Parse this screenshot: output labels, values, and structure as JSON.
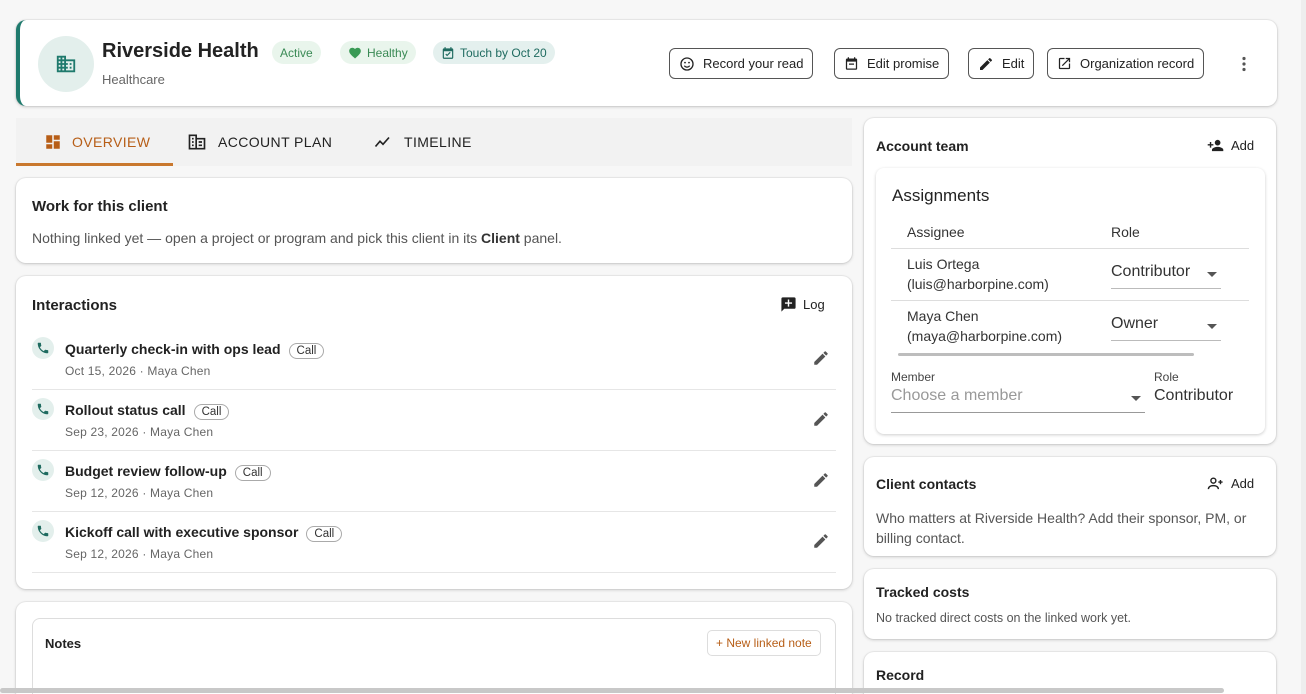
{
  "header": {
    "title": "Riverside Health",
    "subtitle": "Healthcare",
    "badges": {
      "active": "Active",
      "healthy": "Healthy",
      "touch": "Touch by Oct 20"
    },
    "buttons": {
      "record_read": "Record your read",
      "edit_promise": "Edit promise",
      "edit": "Edit",
      "org_record": "Organization record"
    }
  },
  "tabs": [
    {
      "label": "OVERVIEW"
    },
    {
      "label": "ACCOUNT PLAN"
    },
    {
      "label": "TIMELINE"
    }
  ],
  "work": {
    "title": "Work for this client",
    "text_before": "Nothing linked yet — open a project or program and pick this client in its ",
    "text_bold": "Client",
    "text_after": " panel."
  },
  "interactions": {
    "title": "Interactions",
    "log_label": "Log",
    "items": [
      {
        "title": "Quarterly check-in with ops lead",
        "type": "Call",
        "meta": "Oct 15, 2026 · Maya Chen"
      },
      {
        "title": "Rollout status call",
        "type": "Call",
        "meta": "Sep 23, 2026 · Maya Chen"
      },
      {
        "title": "Budget review follow-up",
        "type": "Call",
        "meta": "Sep 12, 2026 · Maya Chen"
      },
      {
        "title": "Kickoff call with executive sponsor",
        "type": "Call",
        "meta": "Sep 12, 2026 · Maya Chen"
      }
    ]
  },
  "notes": {
    "title": "Notes",
    "new_label": "+ New linked note"
  },
  "account_team": {
    "title": "Account team",
    "add_label": "Add",
    "assignments_title": "Assignments",
    "col_assignee": "Assignee",
    "col_role": "Role",
    "rows": [
      {
        "name": "Luis Ortega",
        "email": "(luis@harborpine.com)",
        "role": "Contributor"
      },
      {
        "name": "Maya Chen",
        "email": "(maya@harborpine.com)",
        "role": "Owner"
      }
    ],
    "member_label": "Member",
    "member_placeholder": "Choose a member",
    "role_label": "Role",
    "role_value": "Contributor"
  },
  "client_contacts": {
    "title": "Client contacts",
    "add_label": "Add",
    "text": "Who matters at Riverside Health? Add their sponsor, PM, or billing contact."
  },
  "tracked_costs": {
    "title": "Tracked costs",
    "text": "No tracked direct costs on the linked work yet."
  },
  "record": {
    "title": "Record"
  },
  "colors": {
    "brand": "#1f7a6d",
    "accent_tab": "#b75e17",
    "note_accent": "#b75e17"
  }
}
